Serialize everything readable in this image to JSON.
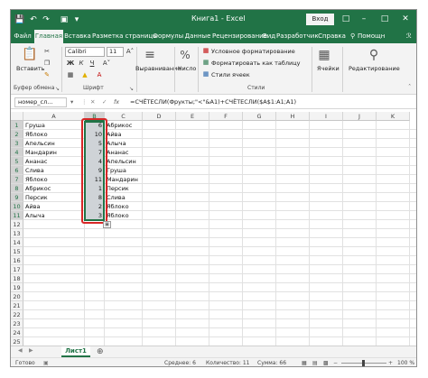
{
  "colors": {
    "accent": "#217346",
    "highlight_box": "#d82727",
    "selection_fill": "#cfd3d7"
  },
  "title_bar": {
    "title": "Книга1 - Excel",
    "signin_label": "Вход",
    "icons": [
      "save-icon",
      "undo-icon",
      "redo-icon",
      "camera-icon",
      "customize-icon",
      "ribbon-display-icon",
      "minimize-icon",
      "maximize-icon",
      "close-icon"
    ]
  },
  "tabs": [
    {
      "label": "Файл"
    },
    {
      "label": "Главная"
    },
    {
      "label": "Вставка"
    },
    {
      "label": "Разметка страницы"
    },
    {
      "label": "Формулы"
    },
    {
      "label": "Данные"
    },
    {
      "label": "Рецензирование"
    },
    {
      "label": "Вид"
    },
    {
      "label": "Разработчик"
    },
    {
      "label": "Справка"
    }
  ],
  "tell_me_label": "Помощн",
  "share_label": "ℛ",
  "ribbon": {
    "paste_label": "Вставить",
    "font_name": "Calibri",
    "font_size": "11",
    "bold": "Ж",
    "italic": "К",
    "underline": "Ч",
    "alignment_label": "Выравнивание",
    "number_label": "Число",
    "conditional_formatting": "Условное форматирование",
    "format_as_table": "Форматировать как таблицу",
    "cell_styles": "Стили ячеек",
    "cells_label": "Ячейки",
    "editing_label": "Редактирование",
    "group_clipboard": "Буфер обмена",
    "group_font": "Шрифт",
    "group_styles": "Стили",
    "percent_symbol": "%"
  },
  "formula_bar": {
    "name_box": "номер_сл...",
    "fx": "fx",
    "formula": "=СЧЁТЕСЛИ(Фрукты;\"<\"&A1)+СЧЁТЕСЛИ($A$1:A1;A1)"
  },
  "grid": {
    "columns": [
      "A",
      "B",
      "C",
      "D",
      "E",
      "F",
      "G",
      "H",
      "I",
      "J",
      "K"
    ],
    "rows": [
      "1",
      "2",
      "3",
      "4",
      "5",
      "6",
      "7",
      "8",
      "9",
      "10",
      "11",
      "12",
      "13",
      "14",
      "15",
      "16",
      "17",
      "18",
      "19",
      "20",
      "21",
      "22",
      "23",
      "24",
      "25"
    ],
    "column_a": [
      "Груша",
      "Яблоко",
      "Апельсин",
      "Мандарин",
      "Ананас",
      "Слива",
      "Яблоко",
      "Абрикос",
      "Персик",
      "Айва",
      "Алыча"
    ],
    "column_b": [
      "6",
      "10",
      "5",
      "7",
      "4",
      "9",
      "11",
      "1",
      "8",
      "2",
      "3"
    ],
    "column_c": [
      "Абрикос",
      "Айва",
      "Алыча",
      "Ананас",
      "Апельсин",
      "Груша",
      "Мандарин",
      "Персик",
      "Слива",
      "Яблоко",
      "Яблоко"
    ]
  },
  "sheet_tabs": {
    "active": "Лист1",
    "add": "⊕"
  },
  "status_bar": {
    "ready": "Готово",
    "average": "Среднее: 6",
    "count": "Количество: 11",
    "sum": "Сумма: 66",
    "zoom": "100 %"
  }
}
